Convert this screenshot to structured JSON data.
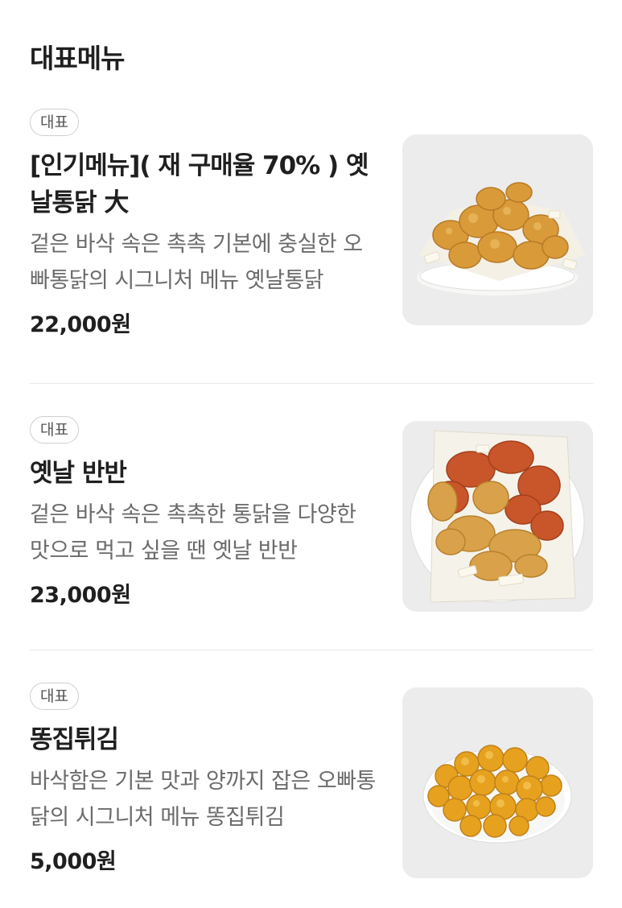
{
  "section": {
    "title": "대표메뉴"
  },
  "items": [
    {
      "badge": "대표",
      "name": "[인기메뉴]( 재 구매율 70% ) 옛날통닭 大",
      "description": "겉은 바삭 속은 촉촉 기본에 충실한 오빠통닭의 시그니처 메뉴 옛날통닭",
      "price": "22,000원",
      "image": "fried-chicken-plate-photo"
    },
    {
      "badge": "대표",
      "name": "옛날 반반",
      "description": "겉은 바삭 속은 촉촉한 통닭을 다양한 맛으로 먹고 싶을 땐 옛날 반반",
      "price": "23,000원",
      "image": "half-half-chicken-plate-photo"
    },
    {
      "badge": "대표",
      "name": "똥집튀김",
      "description": "바삭함은 기본 맛과 양까지 잡은 오빠통닭의 시그니처 메뉴 똥집튀김",
      "price": "5,000원",
      "image": "fried-gizzard-plate-photo"
    }
  ],
  "colors": {
    "title": "#1f1f1f",
    "description": "#6b6b6b",
    "badge_border": "#cfcfcf",
    "divider": "#e7e7e7",
    "thumb_background": "#ececec"
  }
}
